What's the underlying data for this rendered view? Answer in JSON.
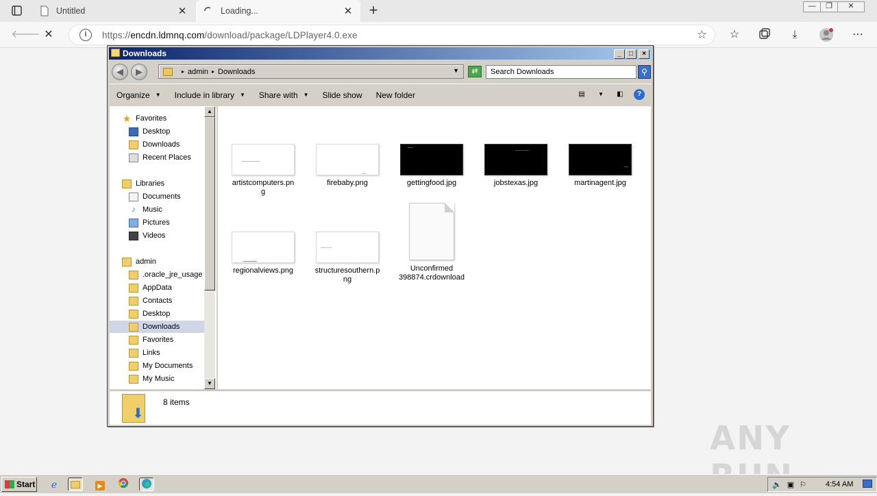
{
  "browser": {
    "tabs": [
      {
        "title": "Untitled",
        "close": "✕"
      },
      {
        "title": "Loading...",
        "close": "✕"
      }
    ],
    "new_tab": "+",
    "url_prefix": "https://",
    "url_domain": "encdn.ldmnq.com",
    "url_path": "/download/package/LDPlayer4.0.exe",
    "window_controls": [
      "—",
      "❐",
      "✕"
    ]
  },
  "explorer": {
    "title": "Downloads",
    "breadcrumb": [
      "admin",
      "Downloads"
    ],
    "search_placeholder": "Search Downloads",
    "commands": [
      "Organize",
      "Include in library",
      "Share with",
      "Slide show",
      "New folder"
    ],
    "nav": {
      "favorites_header": "Favorites",
      "favorites": [
        "Desktop",
        "Downloads",
        "Recent Places"
      ],
      "libraries_header": "Libraries",
      "libraries": [
        "Documents",
        "Music",
        "Pictures",
        "Videos"
      ],
      "user_header": "admin",
      "user_items": [
        ".oracle_jre_usage",
        "AppData",
        "Contacts",
        "Desktop",
        "Downloads",
        "Favorites",
        "Links",
        "My Documents",
        "My Music"
      ],
      "selected": "Downloads"
    },
    "files": [
      {
        "name": "artistcomputers.png",
        "kind": "light"
      },
      {
        "name": "firebaby.png",
        "kind": "light"
      },
      {
        "name": "gettingfood.jpg",
        "kind": "dark"
      },
      {
        "name": "jobstexas.jpg",
        "kind": "dark"
      },
      {
        "name": "martinagent.jpg",
        "kind": "dark"
      },
      {
        "name": "regionalviews.png",
        "kind": "light"
      },
      {
        "name": "structuresouthern.png",
        "kind": "light"
      },
      {
        "name": "Unconfirmed 398874.crdownload",
        "kind": "doc"
      }
    ],
    "status_count": "8 items"
  },
  "taskbar": {
    "start_label": "Start",
    "clock": "4:54 AM"
  },
  "watermark": "ANY RUN"
}
